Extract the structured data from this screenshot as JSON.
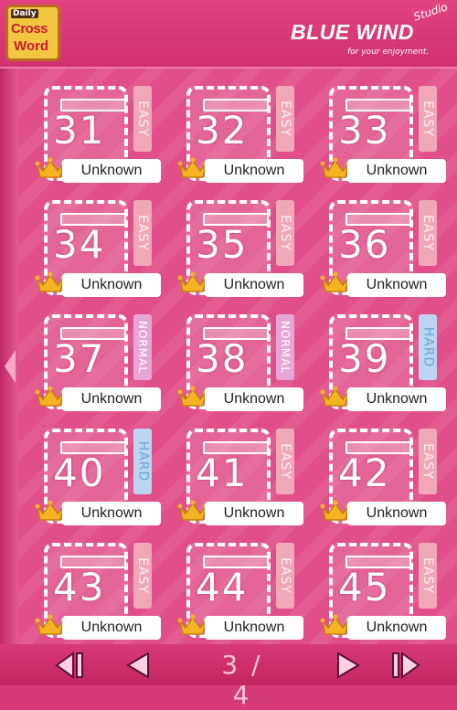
{
  "header": {
    "logo_daily": "Daily",
    "logo_cross": "Cross",
    "logo_word": "Word",
    "brand": "BLUE WIND",
    "brand_studio": "Studio",
    "brand_tag": "for your enjoyment."
  },
  "puzzles": [
    {
      "number": "31",
      "difficulty": "EASY",
      "status": "Unknown"
    },
    {
      "number": "32",
      "difficulty": "EASY",
      "status": "Unknown"
    },
    {
      "number": "33",
      "difficulty": "EASY",
      "status": "Unknown"
    },
    {
      "number": "34",
      "difficulty": "EASY",
      "status": "Unknown"
    },
    {
      "number": "35",
      "difficulty": "EASY",
      "status": "Unknown"
    },
    {
      "number": "36",
      "difficulty": "EASY",
      "status": "Unknown"
    },
    {
      "number": "37",
      "difficulty": "NORMAL",
      "status": "Unknown"
    },
    {
      "number": "38",
      "difficulty": "NORMAL",
      "status": "Unknown"
    },
    {
      "number": "39",
      "difficulty": "HARD",
      "status": "Unknown"
    },
    {
      "number": "40",
      "difficulty": "HARD",
      "status": "Unknown"
    },
    {
      "number": "41",
      "difficulty": "EASY",
      "status": "Unknown"
    },
    {
      "number": "42",
      "difficulty": "EASY",
      "status": "Unknown"
    },
    {
      "number": "43",
      "difficulty": "EASY",
      "status": "Unknown"
    },
    {
      "number": "44",
      "difficulty": "EASY",
      "status": "Unknown"
    },
    {
      "number": "45",
      "difficulty": "EASY",
      "status": "Unknown"
    }
  ],
  "pagination": {
    "page_indicator": "3 / 4",
    "buttons": [
      "first-page-icon",
      "prev-page-icon",
      "next-page-icon",
      "last-page-icon"
    ]
  },
  "colors": {
    "background": "#e04f89",
    "easy": "#f0a7b8",
    "normal": "#e7a6d6",
    "hard": "#bcd6f2",
    "crown": "#f5b324"
  },
  "icons": {
    "crown": "crown-icon",
    "side_prev": "side-prev-arrow-icon"
  }
}
